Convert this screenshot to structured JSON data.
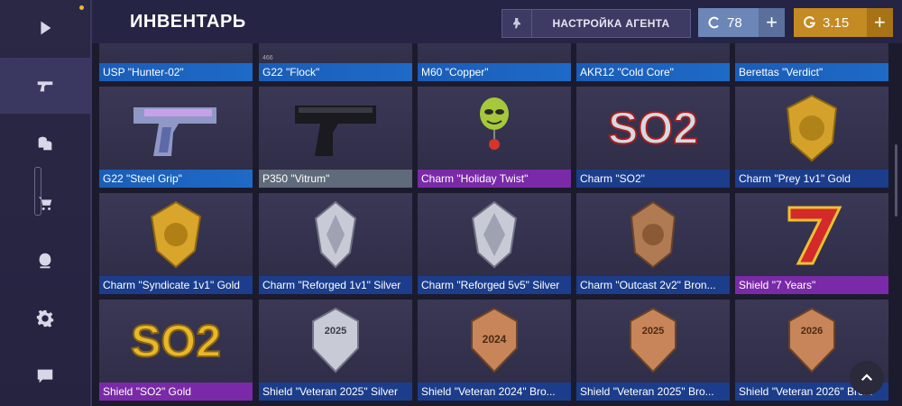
{
  "header": {
    "title": "ИНВЕНТАРЬ",
    "agent_button": "НАСТРОЙКА АГЕНТА",
    "currency_c": "78",
    "currency_g": "3.15",
    "plus": "+"
  },
  "sidebar": {
    "items": [
      {
        "name": "play",
        "icon": "play-icon"
      },
      {
        "name": "weapons",
        "icon": "pistol-icon",
        "active": true
      },
      {
        "name": "coins",
        "icon": "coins-icon"
      },
      {
        "name": "shop",
        "icon": "cart-icon"
      },
      {
        "name": "agent",
        "icon": "agent-icon"
      },
      {
        "name": "settings",
        "icon": "gear-icon"
      },
      {
        "name": "chat",
        "icon": "chat-icon"
      }
    ]
  },
  "items": [
    {
      "label": "USP \"Hunter-02\"",
      "color": "blue"
    },
    {
      "label": "G22 \"Flock\"",
      "color": "blue"
    },
    {
      "label": "M60 \"Copper\"",
      "color": "blue"
    },
    {
      "label": "AKR12 \"Cold Core\"",
      "color": "blue"
    },
    {
      "label": "Berettas \"Verdict\"",
      "color": "blue"
    },
    {
      "label": "G22 \"Steel Grip\"",
      "color": "blue"
    },
    {
      "label": "P350 \"Vitrum\"",
      "color": "gray"
    },
    {
      "label": "Charm \"Holiday Twist\"",
      "color": "purple"
    },
    {
      "label": "Charm \"SO2\"",
      "color": "darkblue"
    },
    {
      "label": "Charm \"Prey 1v1\" Gold",
      "color": "darkblue"
    },
    {
      "label": "Charm \"Syndicate 1v1\" Gold",
      "color": "darkblue"
    },
    {
      "label": "Charm \"Reforged 1v1\" Silver",
      "color": "darkblue"
    },
    {
      "label": "Charm \"Reforged 5v5\" Silver",
      "color": "darkblue"
    },
    {
      "label": "Charm \"Outcast 2v2\" Bron...",
      "color": "darkblue"
    },
    {
      "label": "Shield \"7 Years\"",
      "color": "purple"
    },
    {
      "label": "Shield \"SO2\" Gold",
      "color": "purple"
    },
    {
      "label": "Shield \"Veteran 2025\" Silver",
      "color": "darkblue"
    },
    {
      "label": "Shield \"Veteran 2024\" Bro...",
      "color": "darkblue"
    },
    {
      "label": "Shield \"Veteran 2025\" Bro...",
      "color": "darkblue"
    },
    {
      "label": "Shield \"Veteran 2026\" Bro...",
      "color": "darkblue"
    }
  ],
  "art_text": {
    "so2": "SO2",
    "year2024": "2024",
    "year2025": "2025",
    "year2026": "2026",
    "partial_466": "466"
  }
}
